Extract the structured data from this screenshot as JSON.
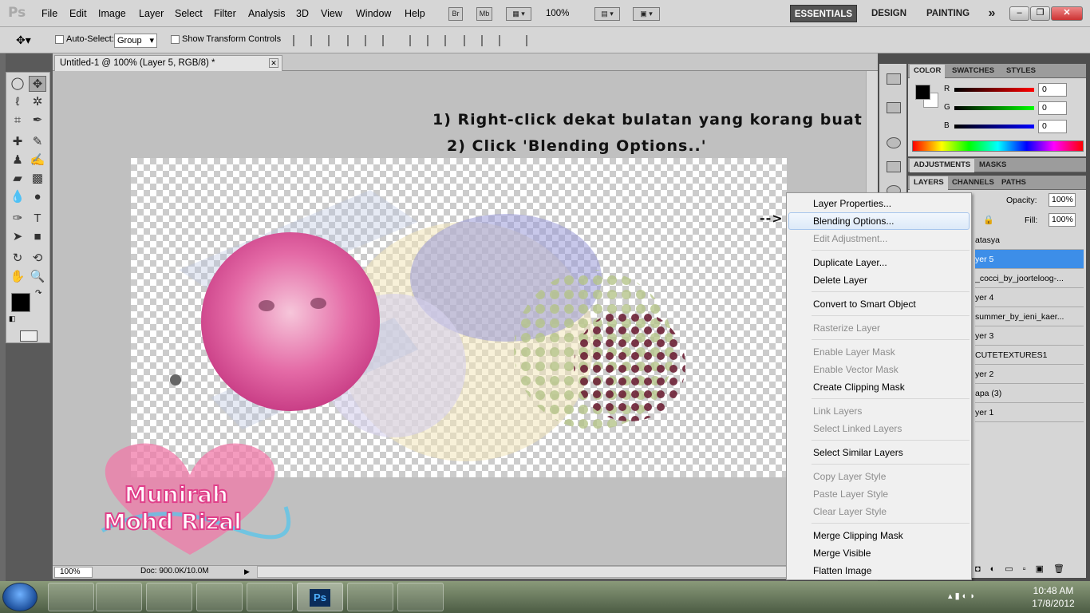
{
  "menubar": {
    "logo": "Ps",
    "items": [
      "File",
      "Edit",
      "Image",
      "Layer",
      "Select",
      "Filter",
      "Analysis",
      "3D",
      "View",
      "Window",
      "Help"
    ],
    "bridge_label": "Br",
    "minibridge_label": "Mb",
    "zoom_level": "100%",
    "workspaces": [
      "ESSENTIALS",
      "DESIGN",
      "PAINTING"
    ],
    "more_workspaces": "»"
  },
  "options": {
    "auto_select_label": "Auto-Select:",
    "auto_select_value": "Group",
    "show_transform_label": "Show Transform Controls"
  },
  "document": {
    "tab_title": "Untitled-1 @ 100% (Layer 5, RGB/8) *",
    "zoom": "100%",
    "doc_size": "Doc: 900.0K/10.0M",
    "annotation_line1": "1) Right-click dekat bulatan yang korang buat",
    "annotation_line2": "2) Click 'Blending Options..'",
    "arrow": "-->",
    "watermark_line1": "Munirah",
    "watermark_line2": "Mohd Rizal"
  },
  "panels": {
    "color_tabs": [
      "COLOR",
      "SWATCHES",
      "STYLES"
    ],
    "adjust_tabs": [
      "ADJUSTMENTS",
      "MASKS"
    ],
    "layer_tabs": [
      "LAYERS",
      "CHANNELS",
      "PATHS"
    ],
    "rgb": [
      {
        "label": "R",
        "value": "0"
      },
      {
        "label": "G",
        "value": "0"
      },
      {
        "label": "B",
        "value": "0"
      }
    ],
    "opacity_label": "Opacity:",
    "opacity_value": "100%",
    "fill_label": "Fill:",
    "fill_value": "100%",
    "layers": [
      "atasya",
      "yer 5",
      "_cocci_by_joorteloog-...",
      "yer 4",
      "summer_by_ieni_kaer...",
      "yer 3",
      "CUTETEXTURES1",
      "yer 2",
      "apa (3)",
      "yer 1"
    ],
    "selected_layer_index": 1
  },
  "context_menu": {
    "items": [
      {
        "label": "Layer Properties...",
        "enabled": true
      },
      {
        "label": "Blending Options...",
        "enabled": true,
        "highlight": true
      },
      {
        "label": "Edit Adjustment...",
        "enabled": false
      },
      {
        "sep": true
      },
      {
        "label": "Duplicate Layer...",
        "enabled": true
      },
      {
        "label": "Delete Layer",
        "enabled": true
      },
      {
        "sep": true
      },
      {
        "label": "Convert to Smart Object",
        "enabled": true
      },
      {
        "sep": true
      },
      {
        "label": "Rasterize Layer",
        "enabled": false
      },
      {
        "sep": true
      },
      {
        "label": "Enable Layer Mask",
        "enabled": false
      },
      {
        "label": "Enable Vector Mask",
        "enabled": false
      },
      {
        "label": "Create Clipping Mask",
        "enabled": true
      },
      {
        "sep": true
      },
      {
        "label": "Link Layers",
        "enabled": false
      },
      {
        "label": "Select Linked Layers",
        "enabled": false
      },
      {
        "sep": true
      },
      {
        "label": "Select Similar Layers",
        "enabled": true
      },
      {
        "sep": true
      },
      {
        "label": "Copy Layer Style",
        "enabled": false
      },
      {
        "label": "Paste Layer Style",
        "enabled": false
      },
      {
        "label": "Clear Layer Style",
        "enabled": false
      },
      {
        "sep": true
      },
      {
        "label": "Merge Clipping Mask",
        "enabled": true
      },
      {
        "label": "Merge Visible",
        "enabled": true
      },
      {
        "label": "Flatten Image",
        "enabled": true
      }
    ]
  },
  "taskbar": {
    "time": "10:48 AM",
    "date": "17/8/2012",
    "apps": [
      "explorer-icon",
      "media-player-icon",
      "chrome-icon",
      "ie-icon",
      "skype-icon",
      "photoshop-icon",
      "paint-icon",
      "misc-app-icon"
    ],
    "ps_label": "Ps"
  },
  "colors": {
    "accent": "#3d8ee8",
    "menu_highlight": "#dce9f8",
    "ps_chrome": "#d6d6d6"
  }
}
